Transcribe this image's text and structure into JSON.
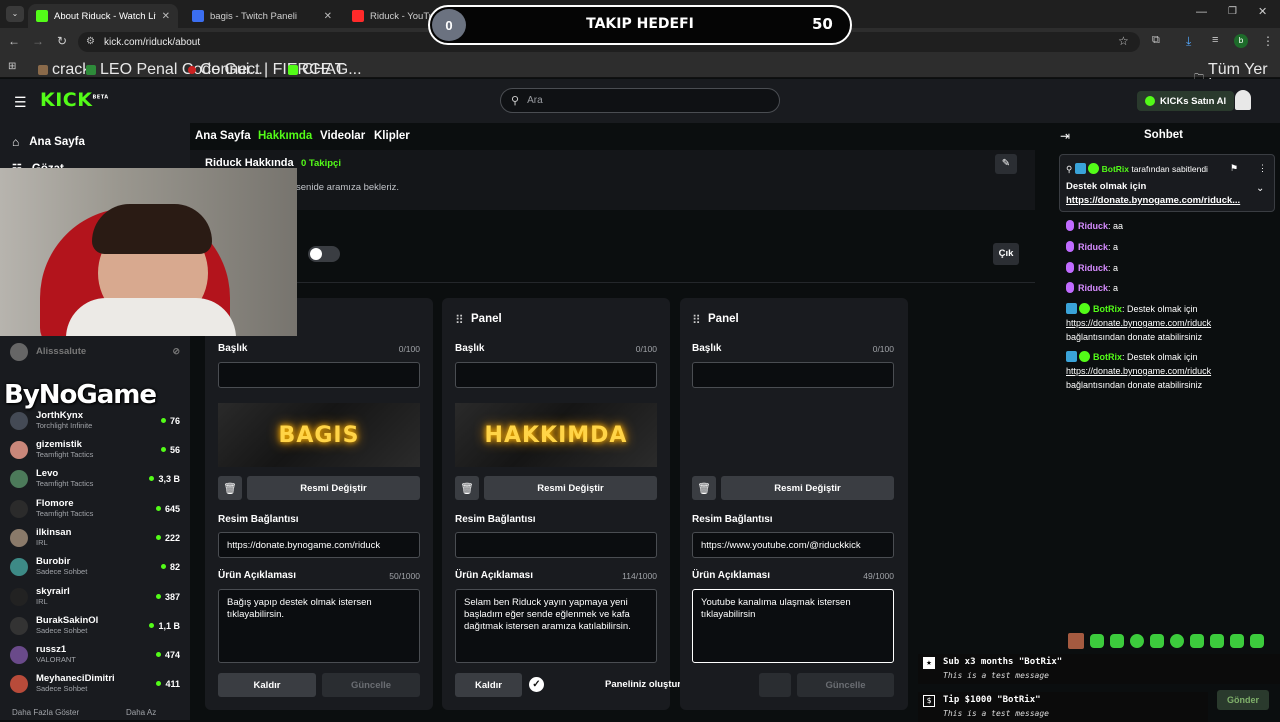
{
  "browser": {
    "tabs": [
      {
        "title": "About Riduck - Watch Live on K",
        "color": "#53fc18"
      },
      {
        "title": "bagis - Twitch Paneli",
        "color": "#3b6ef0"
      },
      {
        "title": "Riduck - YouTube",
        "color": "#ff2a2a"
      }
    ],
    "url": "kick.com/riduck/about",
    "bookmarks": [
      "crack",
      "LEO Penal Code Gui...",
      "Connect | FIERCE G...",
      "CHAT"
    ],
    "all_bookmarks": "Tüm Yer İşaretleri",
    "profile_initial": "b"
  },
  "header": {
    "logo": "KICK",
    "logo_beta": "BETA",
    "search_placeholder": "Ara",
    "kicks_button": "KICKs Satın Al"
  },
  "sidebar": {
    "nav": [
      {
        "label": "Ana Sayfa"
      },
      {
        "label": "Gözat"
      }
    ],
    "channels": [
      {
        "name": "Alisssalute",
        "category": "",
        "count": ""
      },
      {
        "name": "JorthKynx",
        "category": "Torchlight Infinite",
        "count": "76"
      },
      {
        "name": "gizemistik",
        "category": "Teamfight Tactics",
        "count": "56"
      },
      {
        "name": "Levo",
        "category": "Teamfight Tactics",
        "count": "3,3 B"
      },
      {
        "name": "Flomore",
        "category": "Teamfight Tactics",
        "count": "645"
      },
      {
        "name": "ilkinsan",
        "category": "IRL",
        "count": "222"
      },
      {
        "name": "Burobir",
        "category": "Sadece Sohbet",
        "count": "82"
      },
      {
        "name": "skyrairl",
        "category": "IRL",
        "count": "387"
      },
      {
        "name": "BurakSakinOl",
        "category": "Sadece Sohbet",
        "count": "1,1 B"
      },
      {
        "name": "russz1",
        "category": "VALORANT",
        "count": "474"
      },
      {
        "name": "MeyhaneciDimitri",
        "category": "Sadece Sohbet",
        "count": "411"
      }
    ],
    "show_more": "Daha Fazla Göster",
    "show_less": "Daha Az"
  },
  "main": {
    "tabs": [
      "Ana Sayfa",
      "Hakkımda",
      "Videolar",
      "Klipler"
    ],
    "about_title": "Riduck Hakkında",
    "followers": "0 Takipçi",
    "about_text": "ık senide aramıza bekleriz.",
    "exit_button": "Çık",
    "panels": [
      {
        "header": "",
        "title_label": "Başlık",
        "title_counter": "0/100",
        "title_value": "",
        "banner": "BAGIS",
        "change_image": "Resmi Değiştir",
        "link_label": "Resim Bağlantısı",
        "link_value": "https://donate.bynogame.com/riduck",
        "desc_label": "Ürün Açıklaması",
        "desc_counter": "50/1000",
        "desc_value": "Bağış yapıp destek olmak istersen tıklayabilirsin.",
        "remove": "Kaldır",
        "update": "Güncelle"
      },
      {
        "header": "Panel",
        "title_label": "Başlık",
        "title_counter": "0/100",
        "title_value": "",
        "banner": "HAKKIMDA",
        "change_image": "Resmi Değiştir",
        "link_label": "Resim Bağlantısı",
        "link_value": "",
        "desc_label": "Ürün Açıklaması",
        "desc_counter": "114/1000",
        "desc_value": "Selam ben Riduck yayın yapmaya yeni başladım eğer sende eğlenmek ve kafa dağıtmak istersen aramıza katılabilirsin.",
        "remove": "Kaldır",
        "update": "Güncelle",
        "toast": "Paneliniz oluşturuldu."
      },
      {
        "header": "Panel",
        "title_label": "Başlık",
        "title_counter": "0/100",
        "title_value": "",
        "banner": "",
        "change_image": "Resmi Değiştir",
        "link_label": "Resim Bağlantısı",
        "link_value": "https://www.youtube.com/@riduckkick",
        "desc_label": "Ürün Açıklaması",
        "desc_counter": "49/1000",
        "desc_value": "Youtube kanalıma ulaşmak istersen tıklayabilirsin",
        "remove": "Kaldır",
        "update": "Güncelle"
      }
    ]
  },
  "chat": {
    "title": "Sohbet",
    "pinned_by": "BotRix",
    "pinned_suffix": "tarafından sabitlendi",
    "pinned_text": "Destek olmak için",
    "pinned_link": "https://donate.bynogame.com/riduck...",
    "messages": [
      {
        "user": "Riduck",
        "text": "aa"
      },
      {
        "user": "Riduck",
        "text": "a"
      },
      {
        "user": "Riduck",
        "text": "a"
      },
      {
        "user": "Riduck",
        "text": "a"
      }
    ],
    "bot_messages": [
      {
        "user": "BotRix",
        "text": "Destek olmak için",
        "link": "https://donate.bynogame.com/riduck",
        "tail": "bağlantısından donate atabilirsiniz"
      },
      {
        "user": "BotRix",
        "text": "Destek olmak için",
        "link": "https://donate.bynogame.com/riduck",
        "tail": "bağlantısından donate atabilirsiniz"
      }
    ],
    "send_button": "Gönder"
  },
  "overlay": {
    "goal_title": "TAKIP HEDEFI",
    "goal_current": "0",
    "goal_target": "50",
    "brand": "ByNoGame",
    "alerts": [
      {
        "title": "Sub x3 months \"BotRix\"",
        "sub": "This is a test message"
      },
      {
        "title": "Tip $1000 \"BotRix\"",
        "sub": "This is a test message"
      }
    ]
  }
}
